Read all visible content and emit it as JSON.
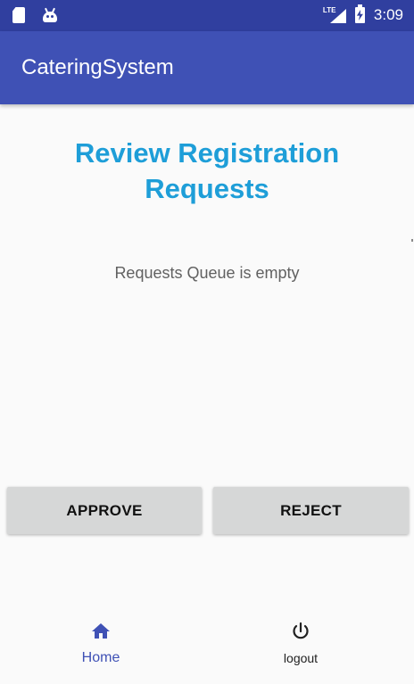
{
  "status_bar": {
    "network_label": "LTE",
    "time": "3:09"
  },
  "app_bar": {
    "title": "CateringSystem"
  },
  "main": {
    "title": "Review Registration Requests",
    "empty_message": "Requests Queue is empty",
    "approve_label": "APPROVE",
    "reject_label": "REJECT"
  },
  "bottom_nav": {
    "items": [
      {
        "label": "Home",
        "icon": "home-icon",
        "active": true
      },
      {
        "label": "logout",
        "icon": "power-icon",
        "active": false
      }
    ]
  },
  "colors": {
    "primary": "#3f51b5",
    "primary_dark": "#303f9f",
    "title_accent": "#1e9ed8",
    "button_bg": "#d6d7d7",
    "background": "#fafafa"
  }
}
